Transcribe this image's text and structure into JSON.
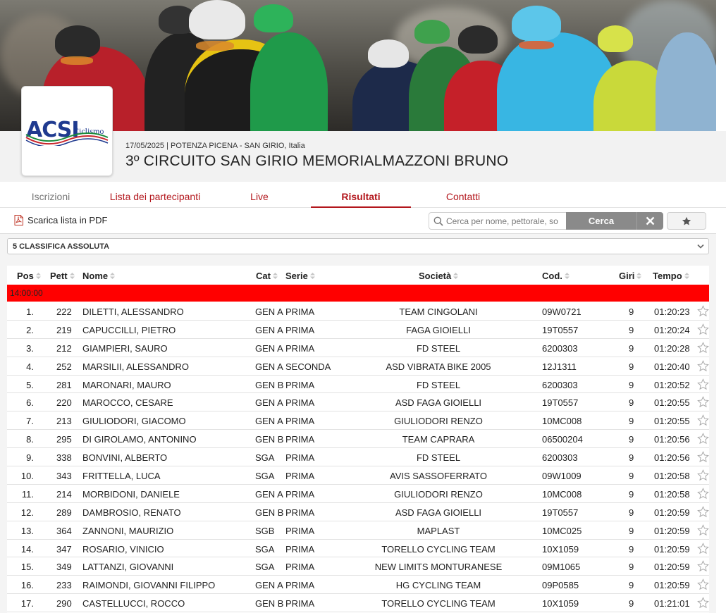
{
  "header": {
    "logo_text": "ACSI",
    "logo_subtext": "Ciclismo",
    "event_meta": "17/05/2025 | POTENZA PICENA - SAN GIRIO, Italia",
    "event_title": "3º CIRCUITO SAN GIRIO MEMORIALMAZZONI BRUNO"
  },
  "tabs": [
    {
      "label": "Iscrizioni",
      "state": "muted"
    },
    {
      "label": "Lista dei partecipanti",
      "state": "normal"
    },
    {
      "label": "Live",
      "state": "normal"
    },
    {
      "label": "Risultati",
      "state": "active"
    },
    {
      "label": "Contatti",
      "state": "normal"
    }
  ],
  "toolbar": {
    "pdf_label": "Scarica lista in PDF",
    "search_placeholder": "Cerca per nome, pettorale, so",
    "search_button": "Cerca"
  },
  "classification": {
    "selected": "5 CLASSIFICA ASSOLUTA"
  },
  "table": {
    "columns": [
      "Pos",
      "Pett",
      "Nome",
      "Cat",
      "Serie",
      "Società",
      "Cod.",
      "Giri",
      "Tempo"
    ],
    "group_label": "14:00:00",
    "rows": [
      {
        "pos": "1.",
        "pett": "222",
        "nome": "DILETTI, ALESSANDRO",
        "cat": "GEN A",
        "serie": "PRIMA",
        "societa": "TEAM CINGOLANI",
        "cod": "09W0721",
        "giri": "9",
        "tempo": "01:20:23"
      },
      {
        "pos": "2.",
        "pett": "219",
        "nome": "CAPUCCILLI, PIETRO",
        "cat": "GEN A",
        "serie": "PRIMA",
        "societa": "FAGA GIOIELLI",
        "cod": "19T0557",
        "giri": "9",
        "tempo": "01:20:24"
      },
      {
        "pos": "3.",
        "pett": "212",
        "nome": "GIAMPIERI, SAURO",
        "cat": "GEN A",
        "serie": "PRIMA",
        "societa": "FD STEEL",
        "cod": "6200303",
        "giri": "9",
        "tempo": "01:20:28"
      },
      {
        "pos": "4.",
        "pett": "252",
        "nome": "MARSILII, ALESSANDRO",
        "cat": "GEN A",
        "serie": "SECONDA",
        "societa": "ASD VIBRATA BIKE 2005",
        "cod": "12J1311",
        "giri": "9",
        "tempo": "01:20:40"
      },
      {
        "pos": "5.",
        "pett": "281",
        "nome": "MARONARI, MAURO",
        "cat": "GEN B",
        "serie": "PRIMA",
        "societa": "FD STEEL",
        "cod": "6200303",
        "giri": "9",
        "tempo": "01:20:52"
      },
      {
        "pos": "6.",
        "pett": "220",
        "nome": "MAROCCO, CESARE",
        "cat": "GEN A",
        "serie": "PRIMA",
        "societa": "ASD FAGA GIOIELLI",
        "cod": "19T0557",
        "giri": "9",
        "tempo": "01:20:55"
      },
      {
        "pos": "7.",
        "pett": "213",
        "nome": "GIULIODORI, GIACOMO",
        "cat": "GEN A",
        "serie": "PRIMA",
        "societa": "GIULIODORI RENZO",
        "cod": "10MC008",
        "giri": "9",
        "tempo": "01:20:55"
      },
      {
        "pos": "8.",
        "pett": "295",
        "nome": "DI GIROLAMO, ANTONINO",
        "cat": "GEN B",
        "serie": "PRIMA",
        "societa": "TEAM CAPRARA",
        "cod": "06500204",
        "giri": "9",
        "tempo": "01:20:56"
      },
      {
        "pos": "9.",
        "pett": "338",
        "nome": "BONVINI, ALBERTO",
        "cat": "SGA",
        "serie": "PRIMA",
        "societa": "FD STEEL",
        "cod": "6200303",
        "giri": "9",
        "tempo": "01:20:56"
      },
      {
        "pos": "10.",
        "pett": "343",
        "nome": "FRITTELLA, LUCA",
        "cat": "SGA",
        "serie": "PRIMA",
        "societa": "AVIS SASSOFERRATO",
        "cod": "09W1009",
        "giri": "9",
        "tempo": "01:20:58"
      },
      {
        "pos": "11.",
        "pett": "214",
        "nome": "MORBIDONI, DANIELE",
        "cat": "GEN A",
        "serie": "PRIMA",
        "societa": "GIULIODORI RENZO",
        "cod": "10MC008",
        "giri": "9",
        "tempo": "01:20:58"
      },
      {
        "pos": "12.",
        "pett": "289",
        "nome": "DAMBROSIO, RENATO",
        "cat": "GEN B",
        "serie": "PRIMA",
        "societa": "ASD FAGA GIOIELLI",
        "cod": "19T0557",
        "giri": "9",
        "tempo": "01:20:59"
      },
      {
        "pos": "13.",
        "pett": "364",
        "nome": "ZANNONI, MAURIZIO",
        "cat": "SGB",
        "serie": "PRIMA",
        "societa": "MAPLAST",
        "cod": "10MC025",
        "giri": "9",
        "tempo": "01:20:59"
      },
      {
        "pos": "14.",
        "pett": "347",
        "nome": "ROSARIO, VINICIO",
        "cat": "SGA",
        "serie": "PRIMA",
        "societa": "TORELLO CYCLING TEAM",
        "cod": "10X1059",
        "giri": "9",
        "tempo": "01:20:59"
      },
      {
        "pos": "15.",
        "pett": "349",
        "nome": "LATTANZI, GIOVANNI",
        "cat": "SGA",
        "serie": "PRIMA",
        "societa": "NEW LIMITS MONTURANESE",
        "cod": "09M1065",
        "giri": "9",
        "tempo": "01:20:59"
      },
      {
        "pos": "16.",
        "pett": "233",
        "nome": "RAIMONDI, GIOVANNI FILIPPO",
        "cat": "GEN A",
        "serie": "PRIMA",
        "societa": "HG CYCLING TEAM",
        "cod": "09P0585",
        "giri": "9",
        "tempo": "01:20:59"
      },
      {
        "pos": "17.",
        "pett": "290",
        "nome": "CASTELLUCCI, ROCCO",
        "cat": "GEN B",
        "serie": "PRIMA",
        "societa": "TORELLO CYCLING TEAM",
        "cod": "10X1059",
        "giri": "9",
        "tempo": "01:21:01"
      }
    ]
  },
  "icons": {
    "pdf": "pdf-file-icon",
    "search": "search-icon",
    "clear": "close-icon",
    "favorite": "star-icon",
    "row_favorite": "star-outline-icon",
    "dropdown": "chevron-down-icon",
    "sort": "sort-arrows-icon"
  },
  "colors": {
    "accent": "#b3171d",
    "group_band": "#ff0000",
    "button_gray": "#8a8a8a",
    "logo_blue": "#1f3a8f"
  }
}
